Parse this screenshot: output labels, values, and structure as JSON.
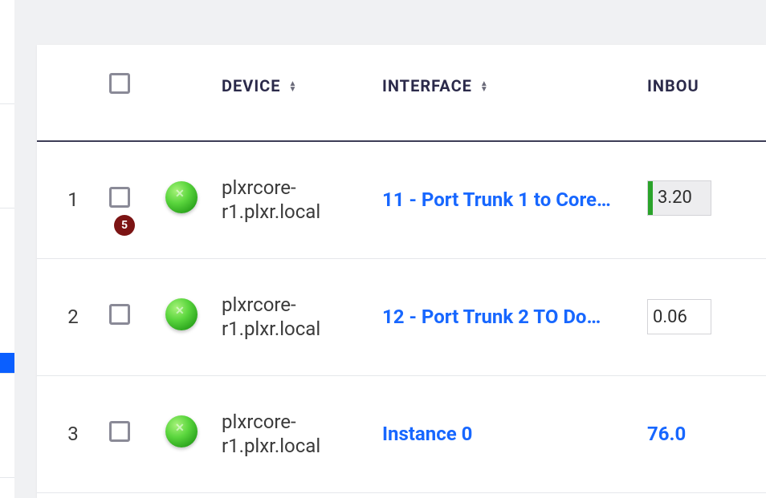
{
  "badge_count": "5",
  "columns": {
    "device": "DEVICE",
    "interface": "INTERFACE",
    "inbound": "INBOU"
  },
  "rows": [
    {
      "num": "1",
      "device": "plxrcore-r1.plxr.local",
      "interface": "11 - Port Trunk 1 to Core…",
      "inbound_type": "bar",
      "inbound": "3.20"
    },
    {
      "num": "2",
      "device": "plxrcore-r1.plxr.local",
      "interface": "12 - Port Trunk 2 TO Do…",
      "inbound_type": "plain",
      "inbound": "0.06"
    },
    {
      "num": "3",
      "device": "plxrcore-r1.plxr.local",
      "interface": "Instance 0",
      "inbound_type": "link",
      "inbound": "76.0"
    }
  ]
}
